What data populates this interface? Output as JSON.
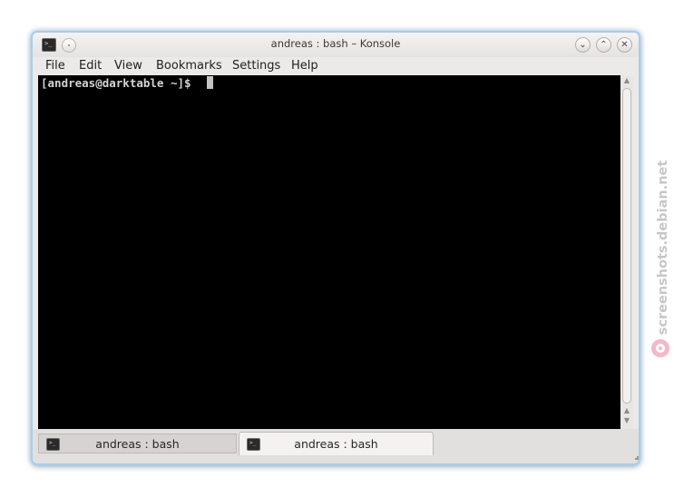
{
  "window": {
    "title": "andreas : bash – Konsole",
    "app_icon": "terminal-icon",
    "controls": [
      "pin-icon",
      "minimize-icon",
      "maximize-icon",
      "close-icon"
    ]
  },
  "menubar": {
    "items": [
      "File",
      "Edit",
      "View",
      "Bookmarks",
      "Settings",
      "Help"
    ]
  },
  "terminal": {
    "prompt": "[andreas@darktable ~]$ ",
    "background": "#000000",
    "foreground": "#d3d3d3"
  },
  "tabs": [
    {
      "label": "andreas : bash",
      "icon": "terminal-icon",
      "active": false
    },
    {
      "label": "andreas : bash",
      "icon": "terminal-icon",
      "active": true
    }
  ],
  "watermark": {
    "text": "screenshots.debian.net",
    "logo": "debian-swirl-logo"
  },
  "colors": {
    "window_glow": "#a9cde7",
    "watermark": "#c7c7c7"
  }
}
